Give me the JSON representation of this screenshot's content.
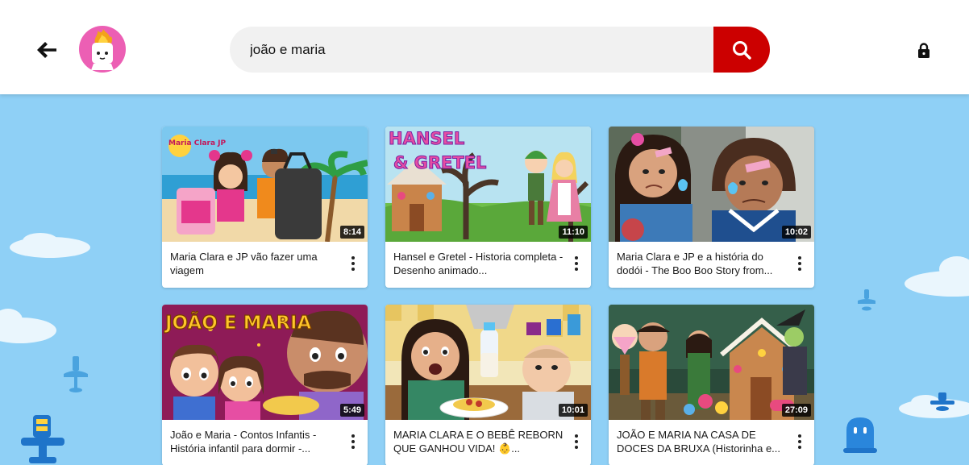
{
  "header": {
    "back_icon": "arrow-left-icon",
    "avatar_icon": "flame-avatar-icon",
    "search": {
      "value": "joão e maria",
      "placeholder": ""
    },
    "search_icon": "search-icon",
    "lock_icon": "lock-icon",
    "colors": {
      "search_button": "#cc0000",
      "avatar_bg": "#ec5fb4"
    }
  },
  "background": {
    "color": "#8fd0f6"
  },
  "videos": [
    {
      "title": "Maria Clara e JP vão fazer uma viagem",
      "duration": "8:14",
      "thumb_logo": "Maria Clara JP"
    },
    {
      "title": "Hansel e Gretel - Historia completa - Desenho animado...",
      "duration": "11:10",
      "thumb_text_1": "HANSEL",
      "thumb_text_2": "& GRETEL"
    },
    {
      "title": "Maria Clara e JP e a história do dodói - The Boo Boo Story from...",
      "duration": "10:02"
    },
    {
      "title": "João e Maria - Contos Infantis - História infantil para dormir -...",
      "duration": "5:49",
      "thumb_text_1": "JOÃO E MARIA"
    },
    {
      "title": "MARIA CLARA E O BEBÊ REBORN QUE GANHOU VIDA! 👶...",
      "duration": "10:01"
    },
    {
      "title": "JOÃO E MARIA NA CASA DE DOCES DA BRUXA (Historinha e...",
      "duration": "27:09"
    }
  ]
}
